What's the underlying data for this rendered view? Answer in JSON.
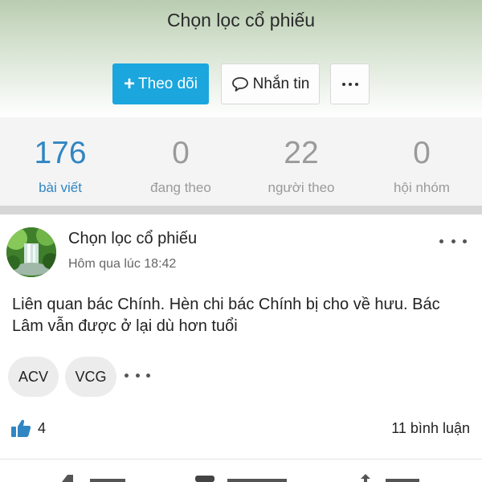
{
  "header": {
    "title": "Chọn lọc cổ phiếu",
    "follow_label": "Theo dõi",
    "follow_plus": "+",
    "message_label": "Nhắn tin"
  },
  "stats": [
    {
      "value": "176",
      "label": "bài viết"
    },
    {
      "value": "0",
      "label": "đang theo"
    },
    {
      "value": "22",
      "label": "người theo"
    },
    {
      "value": "0",
      "label": "hội nhóm"
    }
  ],
  "post": {
    "author": "Chọn lọc cổ phiếu",
    "time": "Hôm qua lúc 18:42",
    "body": "Liên quan bác Chính. Hèn chi bác Chính bị cho về hưu. Bác Lâm vẫn được ở lại dù hơn tuổi",
    "tags": [
      "ACV",
      "VCG"
    ],
    "likes": "4",
    "comments": "11 bình luận"
  },
  "icons": {
    "message": "speech-bubble-icon",
    "more": "ellipsis-icon",
    "like": "thumbs-up-icon"
  },
  "colors": {
    "accent": "#1ba6dd",
    "active_stat": "#2f86c2",
    "inactive_stat": "#9a9a9a",
    "like_icon": "#2f86c2"
  }
}
